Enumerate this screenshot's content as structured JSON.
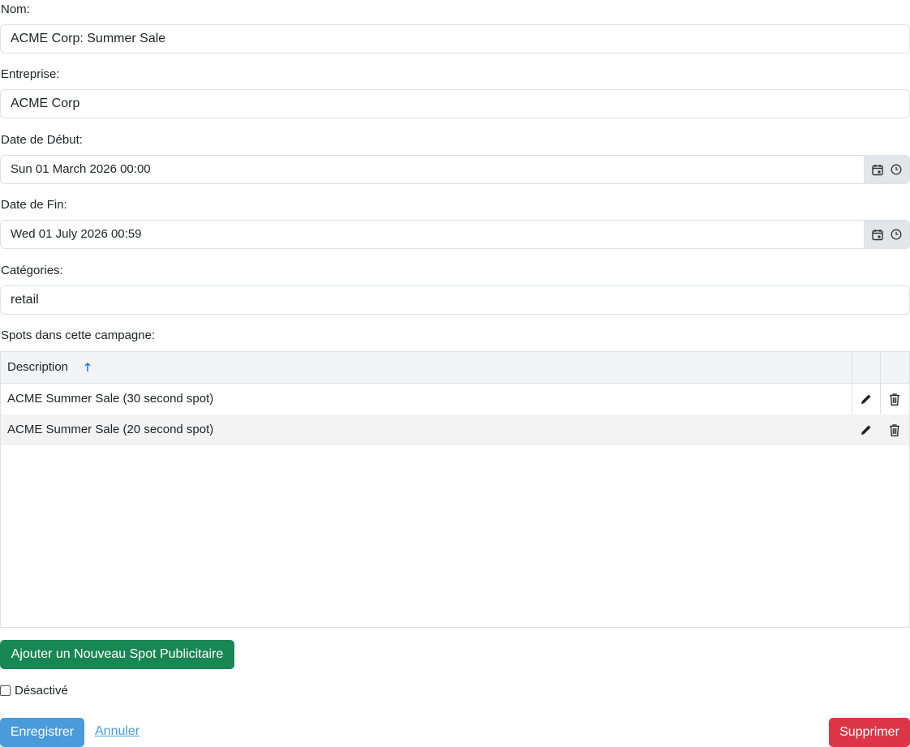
{
  "form": {
    "name_label": "Nom:",
    "name_value": "ACME Corp: Summer Sale",
    "company_label": "Entreprise:",
    "company_value": "ACME Corp",
    "start_label": "Date de Début:",
    "start_value": "Sun 01 March 2026 00:00",
    "end_label": "Date de Fin:",
    "end_value": "Wed 01 July 2026 00:59",
    "categories_label": "Catégories:",
    "categories_value": "retail",
    "spots_label": "Spots dans cette campagne:"
  },
  "spots_table": {
    "column_description": "Description",
    "sort_direction": "ascending",
    "rows": [
      {
        "description": "ACME Summer Sale (30 second spot)"
      },
      {
        "description": "ACME Summer Sale (20 second spot)"
      }
    ]
  },
  "actions": {
    "add_spot_label": "Ajouter un Nouveau Spot Publicitaire",
    "disabled_label": "Désactivé",
    "disabled_checked": false,
    "save_label": "Enregistrer",
    "cancel_label": "Annuler",
    "delete_label": "Supprimer"
  },
  "icons": {
    "calendar": "calendar-icon",
    "clock": "clock-icon",
    "sort": "arrow-up-icon",
    "edit": "pencil-icon",
    "delete": "trash-icon"
  },
  "colors": {
    "primary": "#4a9bd9",
    "success": "#198754",
    "danger": "#dc3545"
  }
}
